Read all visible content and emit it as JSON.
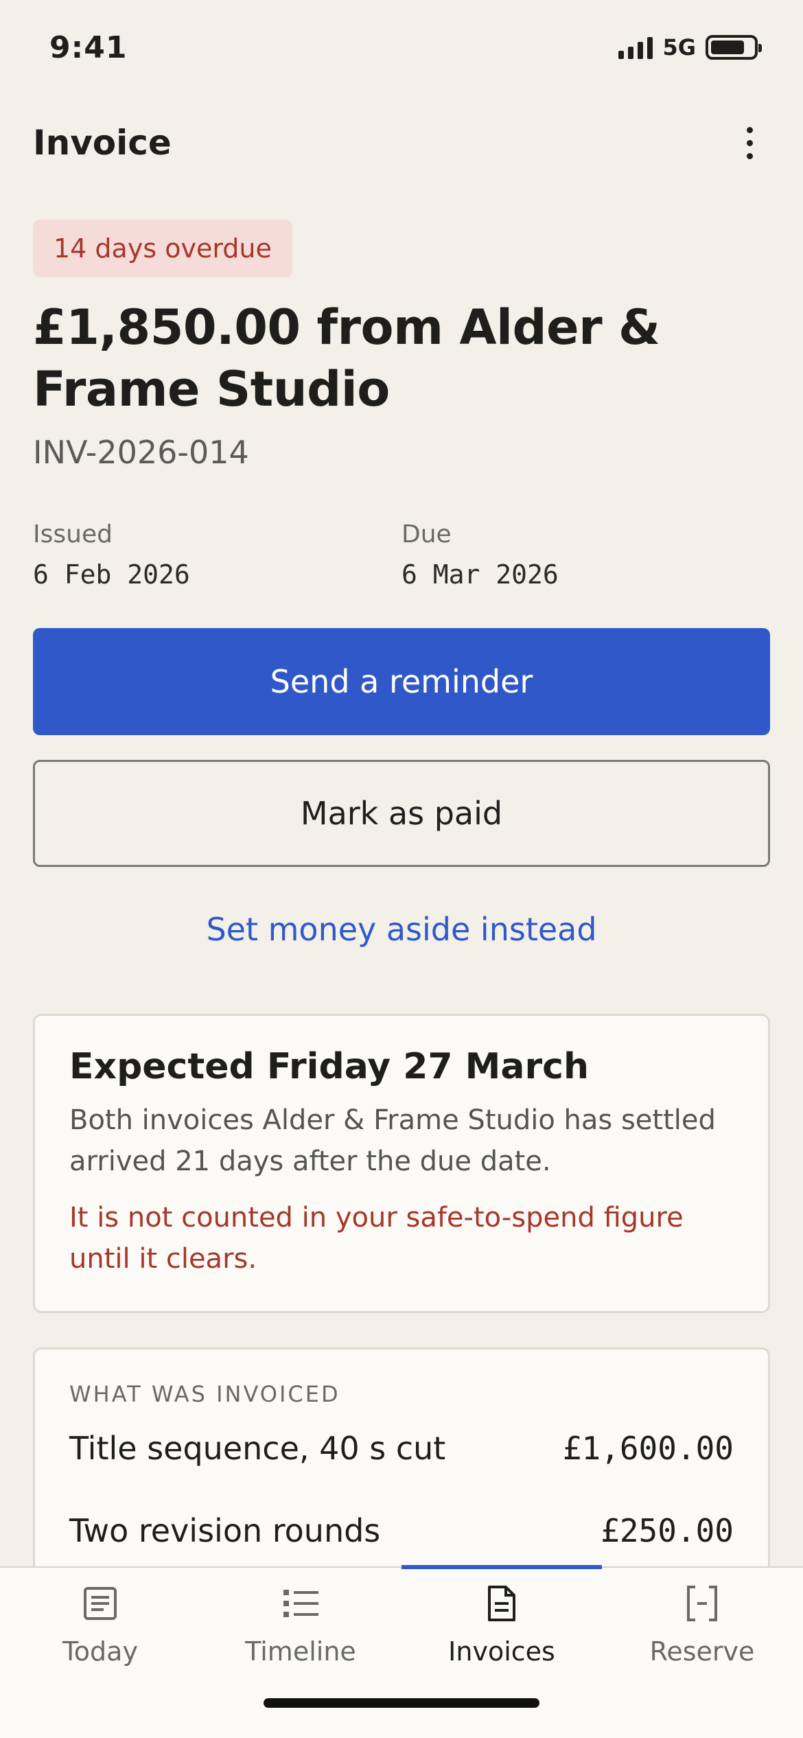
{
  "status_bar": {
    "time": "9:41",
    "network": "5G"
  },
  "header": {
    "title": "Invoice",
    "more_icon": "more-vertical-icon"
  },
  "invoice": {
    "status_badge": "14 days overdue",
    "headline": "£1,850.00 from Alder & Frame Studio",
    "number": "INV-2026-014",
    "issued_label": "Issued",
    "issued_date": "6 Feb 2026",
    "due_label": "Due",
    "due_date": "6 Mar 2026"
  },
  "actions": {
    "primary": "Send a reminder",
    "secondary": "Mark as paid",
    "link": "Set money aside instead"
  },
  "expected_card": {
    "title": "Expected Friday 27 March",
    "body": "Both invoices Alder & Frame Studio has settled arrived 21 days after the due date.",
    "warning": "It is not counted in your safe-to-spend figure until it clears."
  },
  "invoiced_section": {
    "label": "WHAT WAS INVOICED",
    "items": [
      {
        "description": "Title sequence, 40 s cut",
        "amount": "£1,600.00"
      },
      {
        "description": "Two revision rounds",
        "amount": "£250.00"
      }
    ]
  },
  "tab_bar": {
    "active": "Invoices",
    "tabs": [
      {
        "label": "Today",
        "icon": "list-doc-icon"
      },
      {
        "label": "Timeline",
        "icon": "timeline-list-icon"
      },
      {
        "label": "Invoices",
        "icon": "invoice-doc-icon"
      },
      {
        "label": "Reserve",
        "icon": "reserve-bracket-icon"
      }
    ]
  },
  "colors": {
    "background": "#f2f0e9",
    "accent": "#3158c9",
    "overdue_text": "#a6372a",
    "overdue_bg": "#f6dcd8",
    "card_bg": "#fbfaf6"
  }
}
